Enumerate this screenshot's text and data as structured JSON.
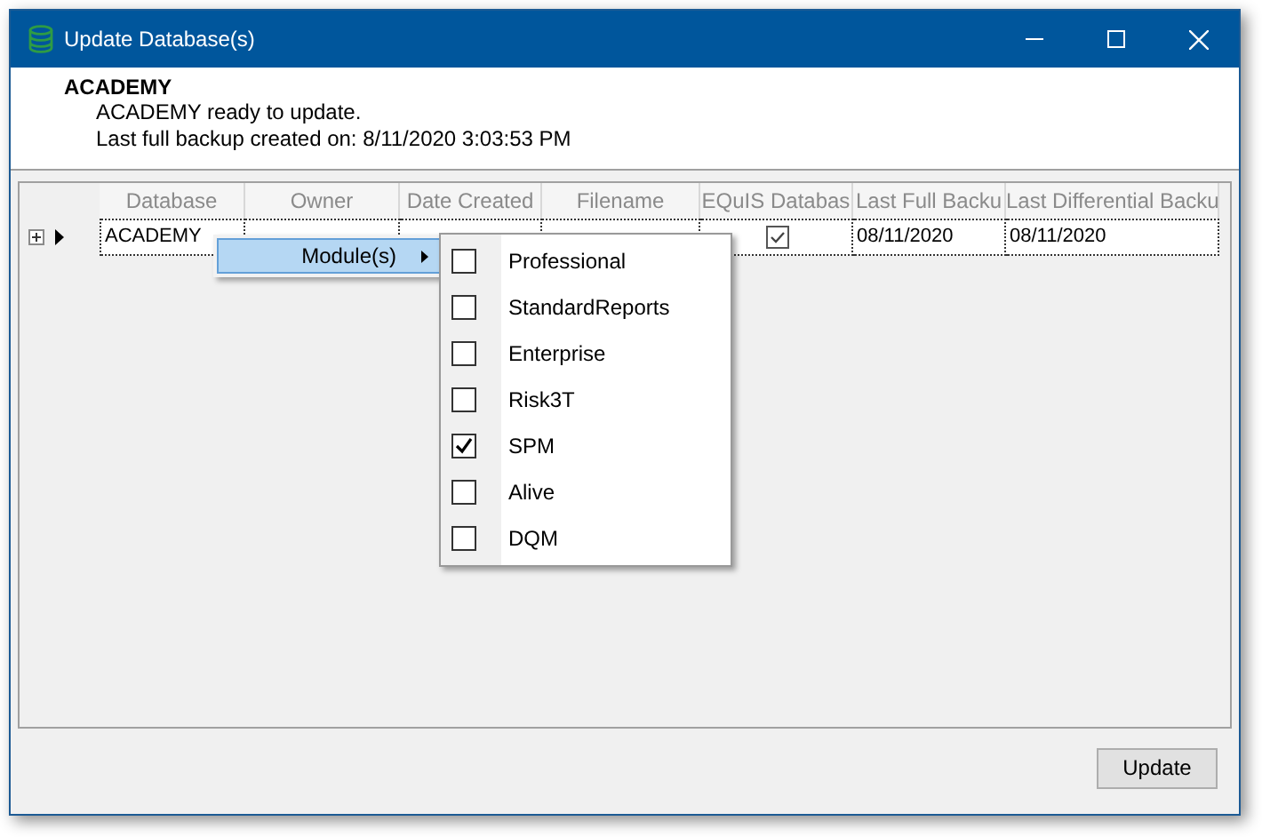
{
  "window": {
    "title": "Update Database(s)"
  },
  "header": {
    "title": "ACADEMY",
    "lines": [
      "ACADEMY ready to update.",
      "Last full backup created on: 8/11/2020 3:03:53 PM"
    ]
  },
  "grid": {
    "columns": [
      "Database",
      "Owner",
      "Date Created",
      "Filename",
      "EQuIS Databas",
      "Last Full Backu",
      "Last Differential Backu"
    ],
    "rows": [
      {
        "selected": true,
        "expanded": false,
        "cells": [
          {
            "kind": "text",
            "text": "ACADEMY"
          },
          {
            "kind": "blank"
          },
          {
            "kind": "blank"
          },
          {
            "kind": "blank"
          },
          {
            "kind": "check",
            "checked": true
          },
          {
            "kind": "text",
            "text": "08/11/2020"
          },
          {
            "kind": "text",
            "text": "08/11/2020"
          }
        ]
      }
    ]
  },
  "context_menu": {
    "items": [
      {
        "label": "Module(s)",
        "selected": true
      }
    ]
  },
  "submenu": {
    "items": [
      {
        "label": "Professional",
        "checked": false
      },
      {
        "label": "StandardReports",
        "checked": false
      },
      {
        "label": "Enterprise",
        "checked": false
      },
      {
        "label": "Risk3T",
        "checked": false
      },
      {
        "label": "SPM",
        "checked": true
      },
      {
        "label": "Alive",
        "checked": false
      },
      {
        "label": "DQM",
        "checked": false
      }
    ]
  },
  "buttons": [
    "Update"
  ]
}
